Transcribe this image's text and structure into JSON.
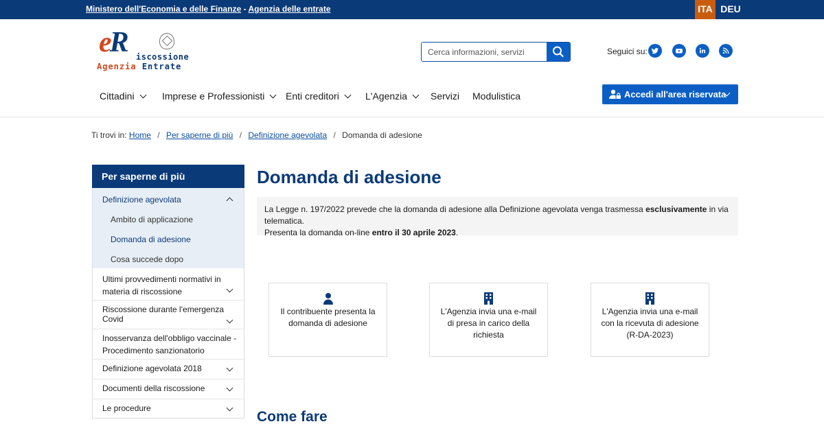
{
  "topbar": {
    "link_mef": "Ministero dell'Economia e delle Finanze",
    "separator": "-",
    "link_agenzia": "Agenzia delle entrate",
    "lang_ita": "ITA",
    "lang_deu": "DEU"
  },
  "logo": {
    "letters_e": "e",
    "letters_r": "R",
    "riscossione": "iscossione",
    "agenzia": "Agenzia",
    "entrate": "Entrate"
  },
  "search": {
    "placeholder": "Cerca informazioni, servizi",
    "icon": "search-icon"
  },
  "social": {
    "label": "Seguici su:",
    "icons": [
      "twitter-icon",
      "youtube-icon",
      "linkedin-icon",
      "rss-icon"
    ]
  },
  "nav": {
    "items": [
      "Cittadini",
      "Imprese e Professionisti",
      "Enti creditori",
      "L'Agenzia",
      "Servizi",
      "Modulistica"
    ],
    "login_button": "Accedi all'area riservata"
  },
  "breadcrumb": {
    "prefix": "Ti trovi in:",
    "items": [
      "Home",
      "Per saperne di più",
      "Definizione agevolata"
    ],
    "current": "Domanda di adesione"
  },
  "sidebar": {
    "title": "Per saperne di più",
    "open_section": "Definizione agevolata",
    "sub_items": [
      "Ambito di applicazione",
      "Domanda di adesione",
      "Cosa succede dopo"
    ],
    "items": [
      {
        "line1": "Ultimi provvedimenti normativi in",
        "line2": "materia di riscossione"
      },
      {
        "line1": "Riscossione durante l'emergenza Covid",
        "line2": ""
      },
      {
        "line1": "Inosservanza dell'obbligo vaccinale -",
        "line2": "Procedimento sanzionatorio"
      },
      {
        "line1": "Definizione agevolata 2018",
        "line2": ""
      },
      {
        "line1": "Documenti della riscossione",
        "line2": ""
      },
      {
        "line1": "Le procedure",
        "line2": ""
      }
    ]
  },
  "main": {
    "title": "Domanda di adesione",
    "notice": {
      "line1_a": "La Legge n. 197/2022 prevede che la domanda di adesione alla Definizione agevolata venga trasmessa ",
      "line1_bold": "esclusivamente",
      "line1_b": " in via telematica.",
      "line2_a": "Presenta la domanda on-line ",
      "line2_bold": "entro il 30 aprile 2023",
      "line2_b": "."
    },
    "cards": [
      {
        "icon": "user-icon",
        "text": "Il contribuente presenta la domanda di adesione"
      },
      {
        "icon": "building-icon",
        "text": "L'Agenzia invia una e-mail di presa in carico della richiesta"
      },
      {
        "icon": "building-icon",
        "text": "L'Agenzia invia una e-mail con la ricevuta di adesione (R-DA-2023)"
      }
    ],
    "section_title": "Come fare"
  },
  "colors": {
    "primary": "#0b3a78",
    "accent": "#0b5fc4",
    "orange": "#c85d0e",
    "logo_red": "#d4481e"
  }
}
